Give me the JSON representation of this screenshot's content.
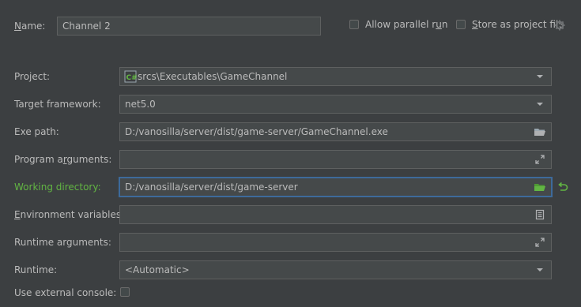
{
  "name": {
    "label_pre": "",
    "label_mn": "N",
    "label_post": "ame:",
    "value": "Channel 2"
  },
  "options": {
    "parallel_pre": "Allow parallel r",
    "parallel_mn": "u",
    "parallel_post": "n",
    "parallel_checked": false,
    "store_pre": "",
    "store_mn": "S",
    "store_post": "tore as project file",
    "store_checked": false
  },
  "fields": {
    "project": {
      "label": "Project:",
      "value": "srcs\\Executables\\GameChannel"
    },
    "target_framework": {
      "label": "Target framework:",
      "value": "net5.0"
    },
    "exe_path": {
      "label": "Exe path:",
      "value": "D:/vanosilla/server/dist/game-server/GameChannel.exe"
    },
    "program_arguments": {
      "label_pre": "Program a",
      "label_mn": "r",
      "label_post": "guments:",
      "value": ""
    },
    "working_directory": {
      "label": "Working directory:",
      "value": "D:/vanosilla/server/dist/game-server"
    },
    "environment_variables": {
      "label_pre": "",
      "label_mn": "E",
      "label_post": "nvironment variables:",
      "value": ""
    },
    "runtime_arguments": {
      "label": "Runtime arguments:",
      "value": ""
    },
    "runtime": {
      "label": "Runtime:",
      "value": "<Automatic>"
    },
    "external_console": {
      "label": "Use external console:",
      "checked": false
    }
  },
  "colors": {
    "background": "#3c3f41",
    "field_bg": "#45494a",
    "label_active": "#62b543",
    "focus_border": "#3d6a9b"
  },
  "icons": {
    "project": "csharp-project-icon",
    "dropdown": "chevron-down-icon",
    "browse": "folder-open-icon",
    "expand": "expand-icon",
    "env_edit": "document-list-icon",
    "reset": "reset-undo-icon",
    "settings": "gear-icon"
  }
}
